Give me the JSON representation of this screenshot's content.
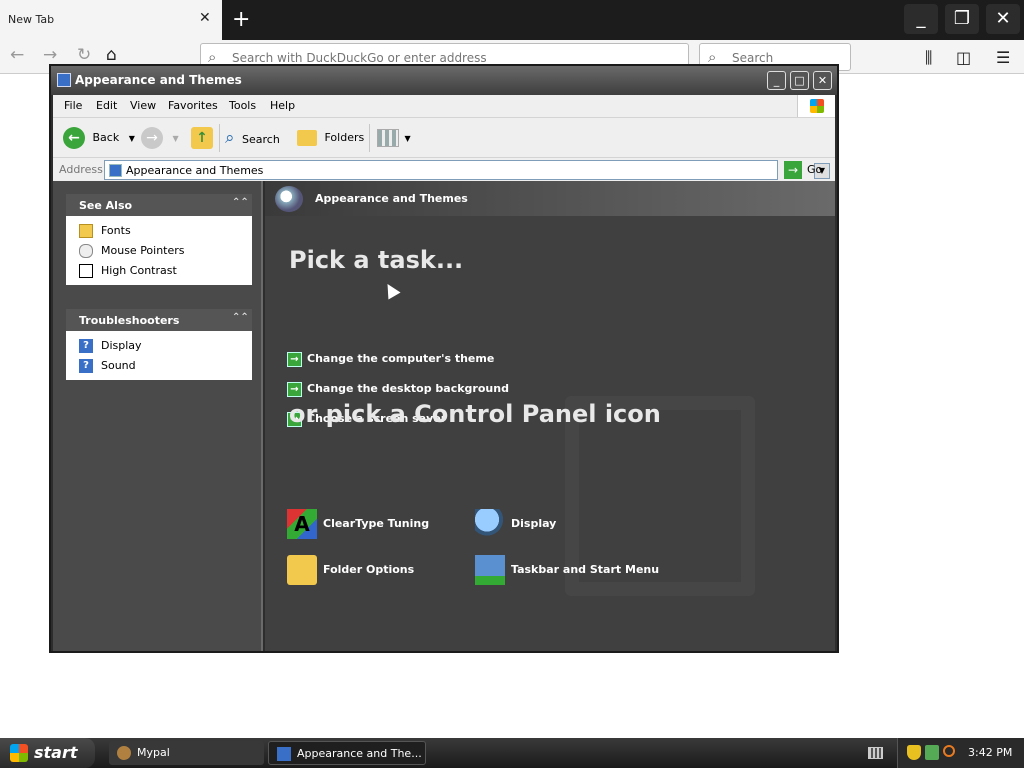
{
  "browser": {
    "tab_title": "New Tab",
    "tab_close": "✕",
    "new_tab": "+",
    "url_placeholder": "Search with DuckDuckGo or enter address",
    "search_placeholder": "Search",
    "icons": [
      "back-arrow",
      "forward-arrow",
      "reload",
      "home",
      "library",
      "sidebar",
      "hamburger-menu"
    ]
  },
  "window": {
    "title": "Appearance and Themes",
    "menu": [
      "File",
      "Edit",
      "View",
      "Favorites",
      "Tools",
      "Help"
    ],
    "toolbar": {
      "back": "Back",
      "search": "Search",
      "folders": "Folders"
    },
    "address": {
      "label": "Address",
      "value": "Appearance and Themes",
      "go": "Go"
    }
  },
  "task_pane": {
    "see_also": {
      "title": "See Also",
      "items": [
        "Fonts",
        "Mouse Pointers",
        "High Contrast"
      ]
    },
    "troubleshooters": {
      "title": "Troubleshooters",
      "items": [
        "Display",
        "Sound"
      ]
    }
  },
  "main": {
    "header": "Appearance and Themes",
    "pick_task": "Pick a task...",
    "tasks": [
      "Change the computer's theme",
      "Change the desktop background",
      "Choose a screen saver"
    ],
    "pick_icon": "or pick a Control Panel icon",
    "icons": [
      "ClearType Tuning",
      "Display",
      "Folder Options",
      "Taskbar and Start Menu"
    ]
  },
  "taskbar": {
    "start": "start",
    "buttons": [
      "Mypal",
      "Appearance and The..."
    ],
    "clock": "3:42 PM"
  },
  "colors": {
    "window_bg": "#2d2d2d",
    "task_pane_bg": "#4a4a4a",
    "main_bg": "#404040",
    "task_arrow": "#39a53a"
  }
}
